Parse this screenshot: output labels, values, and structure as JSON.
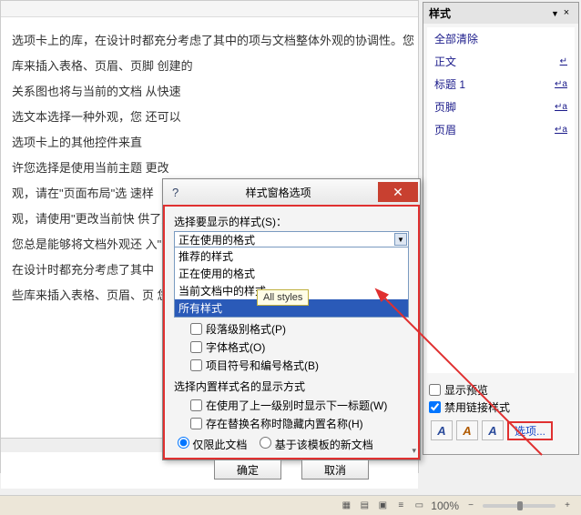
{
  "doc": {
    "p1": "选项卡上的库，在设计时都充分考虑了其中的项与文档整体外观的协调性。您",
    "p2": "库来插入表格、页眉、页脚                                           创建的",
    "p3": "关系图也将与当前的文档                                             从快速",
    "p4": "选文本选择一种外观，您                                             还可以",
    "p5": "选项卡上的其他控件来直",
    "p6": "许您选择是使用当前主题                                             更改",
    "p7": "观，请在\"页面布局\"选                                              速样",
    "p8": "观，请使用\"更改当前快                                              供了重",
    "p9": "您总是能够将文档外观还                                              入\"选",
    "p10": "在设计时都充分考虑了其中",
    "p11": "些库来插入表格、页眉、页                                            您创建"
  },
  "stylesPane": {
    "title": "样式",
    "items": [
      {
        "label": "全部清除",
        "ind": ""
      },
      {
        "label": "正文",
        "ind": "↵"
      },
      {
        "label": "标题 1",
        "ind": "↵a"
      },
      {
        "label": "页脚",
        "ind": "↵a"
      },
      {
        "label": "页眉",
        "ind": "↵a"
      }
    ],
    "showPreview": "显示预览",
    "disableLinked": "禁用链接样式",
    "optionsLink": "选项..."
  },
  "dialog": {
    "title": "样式窗格选项",
    "selectStylesLabel": "选择要显示的样式(S)：",
    "comboValue": "正在使用的格式",
    "dropdownItems": [
      "推荐的样式",
      "正在使用的格式",
      "当前文档中的样式",
      "所有样式"
    ],
    "selectedDropdown": 3,
    "tooltip": "All styles",
    "chkParagraph": "段落级别格式(P)",
    "chkFont": "字体格式(O)",
    "chkBullets": "项目符号和编号格式(B)",
    "builtinLabel": "选择内置样式名的显示方式",
    "chkNextHeading": "在使用了上一级别时显示下一标题(W)",
    "chkHideReplace": "存在替换名称时隐藏内置名称(H)",
    "radioThisDoc": "仅限此文档",
    "radioTemplate": "基于该模板的新文档",
    "btnOK": "确定",
    "btnCancel": "取消"
  },
  "status": {
    "zoom": "100%"
  }
}
